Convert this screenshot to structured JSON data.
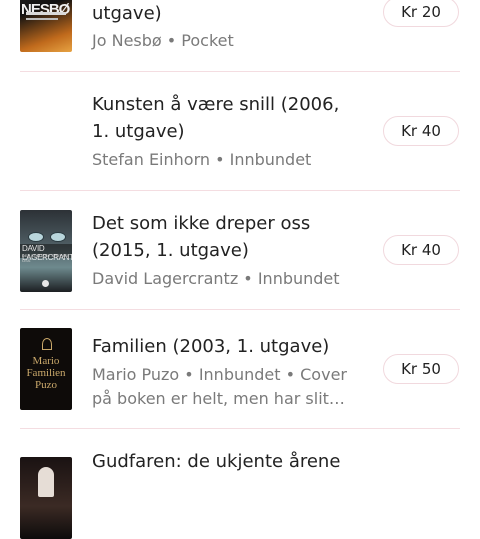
{
  "books": [
    {
      "title": "utgave)",
      "meta": "Jo Nesbø • Pocket",
      "price": "Kr 20",
      "cover": "cover-nesbo",
      "cover_text": "JO NESBØ"
    },
    {
      "title": "Kunsten å være snill (2006, 1. utgave)",
      "meta": "Stefan Einhorn • Innbundet",
      "price": "Kr 40",
      "cover": "none"
    },
    {
      "title": "Det som ikke dreper oss (2015, 1. utgave)",
      "meta": "David Lagercrantz • Innbundet",
      "price": "Kr 40",
      "cover": "cover-lagercrantz",
      "cover_text": "DAVID LAGERCRANTZ",
      "cover_sub": "DET SOM IKKE DREPER OSS"
    },
    {
      "title": "Familien (2003, 1. utgave)",
      "meta": "Mario Puzo • Innbundet • Cover på boken er helt, men har slit…",
      "price": "Kr 50",
      "cover": "cover-puzo",
      "cover_text_1": "Mario",
      "cover_text_2": "Familien",
      "cover_text_3": "Puzo"
    },
    {
      "title": "Gudfaren: de ukjente årene",
      "cover": "cover-gudfaren"
    }
  ],
  "colors": {
    "divider": "#f4dde1",
    "price_border": "#f1d9de",
    "meta_text": "#7a7a7a"
  }
}
